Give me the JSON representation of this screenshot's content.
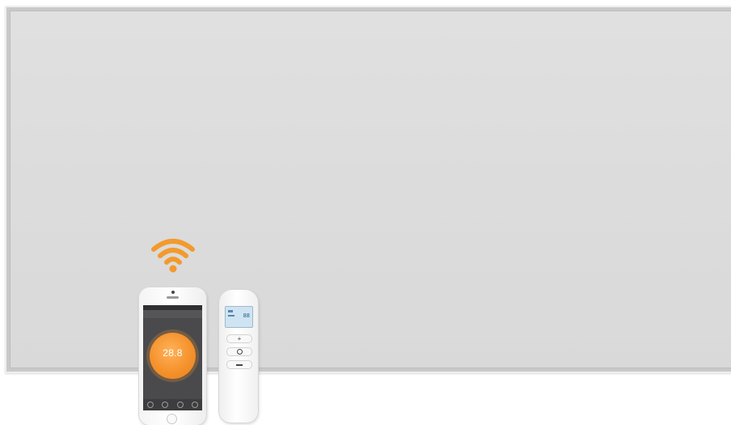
{
  "scene": {
    "panel_color": "#dcdcdc",
    "frame_color": "#c9c9c9",
    "wifi_color": "#f39a2c"
  },
  "phone": {
    "temperature": "28.8",
    "dial_color": "#f5922c"
  },
  "icons": [
    "wifi-icon",
    "power-icon",
    "plus-icon",
    "minus-icon"
  ]
}
